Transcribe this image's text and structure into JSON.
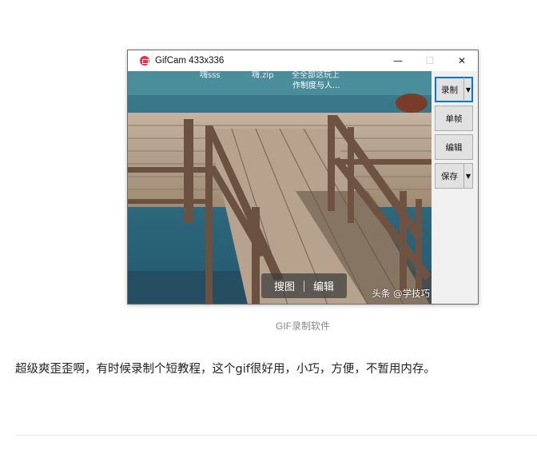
{
  "window": {
    "title": "GifCam 433x336",
    "minimize": "—",
    "maximize": "☐",
    "close": "✕"
  },
  "capture": {
    "overlay_top": [
      "嗨sss",
      "嗨.zip",
      "全全部这玩上",
      "作制度与人..."
    ],
    "toolbar": {
      "search_image": "搜图",
      "edit": "编辑"
    },
    "watermark": "头条 @学技巧"
  },
  "buttons": {
    "record": "录制",
    "single_frame": "单帧",
    "edit": "编辑",
    "save": "保存",
    "dropdown_arrow": "▼"
  },
  "article": {
    "caption": "GIF录制软件",
    "paragraph": "超级爽歪歪啊，有时候录制个短教程，这个gif很好用，小巧，方便，不暂用内存。"
  },
  "colors": {
    "app_icon": "#e8334b",
    "focus_border": "#0078d7",
    "water": "#2f6e8a",
    "wood": "#b9a48c"
  },
  "icons": {
    "app": "gifcam-app-icon"
  }
}
